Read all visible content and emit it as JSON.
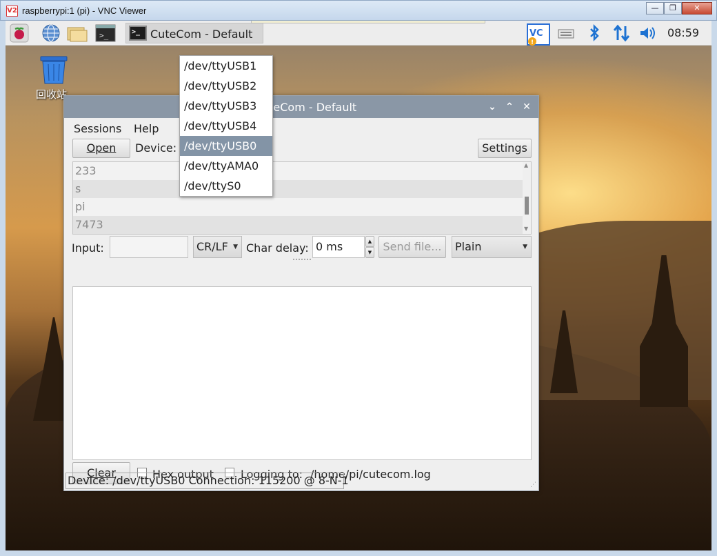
{
  "vnc": {
    "logo": "V2",
    "title": "raspberrypi:1 (pi) - VNC Viewer",
    "buttons": [
      "minimize",
      "restore",
      "close"
    ]
  },
  "panel": {
    "task_label": "CuteCom - Default",
    "clock": "08:59",
    "launcher_icons": [
      "raspberry-menu-icon",
      "web-browser-icon",
      "file-manager-icon",
      "terminal-icon"
    ],
    "tray_icons": [
      "vnc-server-icon",
      "keyboard-icon",
      "bluetooth-icon",
      "network-icon",
      "volume-icon"
    ]
  },
  "desktop": {
    "trash_label": "回收站"
  },
  "cutecom": {
    "title": "CuteCom - Default",
    "menu": {
      "sessions": "Sessions",
      "help": "Help"
    },
    "open_label": "Open",
    "device_label": "Device:",
    "settings_label": "Settings",
    "history": [
      "233",
      "s",
      "pi",
      "7473"
    ],
    "input_label": "Input:",
    "line_end": "CR/LF",
    "char_delay_label": "Char delay:",
    "char_delay_value": "0 ms",
    "send_file_label": "Send file...",
    "format": "Plain",
    "clear_label": "Clear",
    "hex_output_label": "Hex output",
    "logging_label": "Logging to:",
    "log_path": "/home/pi/cutecom.log",
    "status": "Device:  /dev/ttyUSB0  Connection:  115200 @ 8-N-1",
    "device_options": [
      "/dev/ttyUSB1",
      "/dev/ttyUSB2",
      "/dev/ttyUSB3",
      "/dev/ttyUSB4",
      "/dev/ttyUSB0",
      "/dev/ttyAMA0",
      "/dev/ttyS0"
    ],
    "selected_device": "/dev/ttyUSB0"
  }
}
